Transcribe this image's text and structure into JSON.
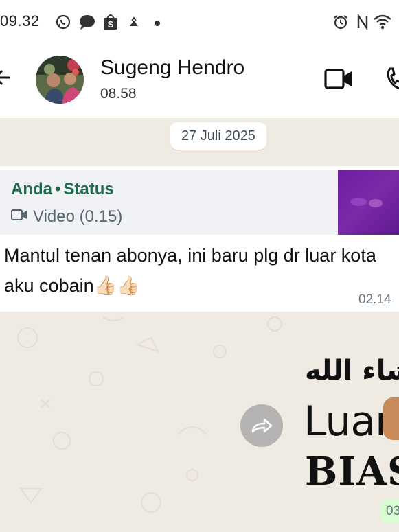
{
  "status_bar": {
    "time": "09.32",
    "left_icons": [
      "whatsapp-icon",
      "chat-bubble-icon",
      "shopee-icon",
      "gallery-icon",
      "dot-icon"
    ],
    "right_icons": [
      "alarm-icon",
      "nfc-icon",
      "wifi-icon"
    ]
  },
  "header": {
    "contact_name": "Sugeng Hendro",
    "last_seen": "08.58",
    "icons": [
      "back-arrow-icon",
      "video-call-icon",
      "phone-call-icon"
    ]
  },
  "chat": {
    "date_chip": "27 Juli 2025",
    "messages": [
      {
        "quote": {
          "author": "Anda",
          "separator": "•",
          "source": "Status",
          "media_label": "Video (0.15)"
        },
        "text": "Mantul tenan abonya, ini baru plg dr luar kota aku cobain👍🏻👍🏻",
        "time": "02.14"
      },
      {
        "type": "sticker",
        "sticker_arabic": "ما شاء الله",
        "sticker_line1": "Luar",
        "sticker_line2": "BIAS",
        "time": "03"
      }
    ]
  },
  "colors": {
    "background": "#efeae2",
    "quote_author": "#1f6b4b",
    "outgoing_bubble": "#d9fdd3",
    "thumbnail": "#6d1fa0"
  }
}
